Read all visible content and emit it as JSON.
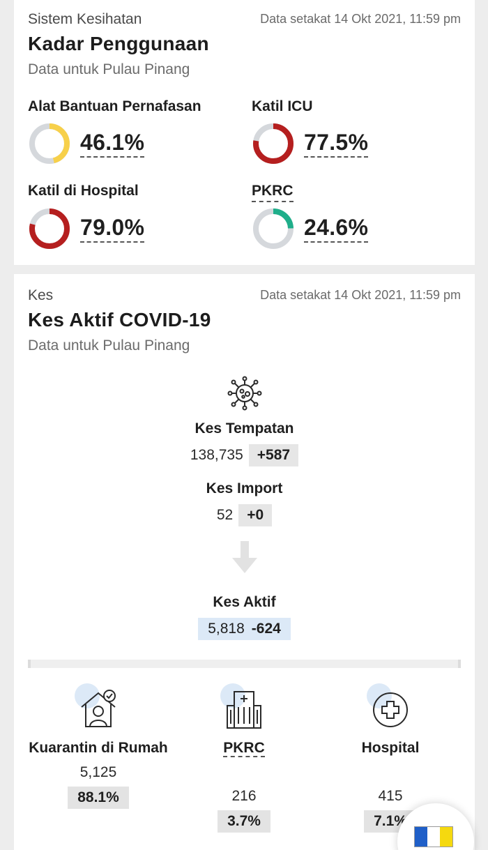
{
  "usage_card": {
    "eyebrow": "Sistem Kesihatan",
    "as_of": "Data setakat 14 Okt 2021, 11:59 pm",
    "title": "Kadar Penggunaan",
    "subtitle": "Data untuk Pulau Pinang",
    "metrics": [
      {
        "label": "Alat Bantuan Pernafasan",
        "value": "46.1%",
        "fraction": 0.461,
        "color": "#f7d04a"
      },
      {
        "label": "Katil ICU",
        "value": "77.5%",
        "fraction": 0.775,
        "color": "#b51f1f"
      },
      {
        "label": "Katil di Hospital",
        "value": "79.0%",
        "fraction": 0.79,
        "color": "#b51f1f"
      },
      {
        "label": "PKRC",
        "value": "24.6%",
        "fraction": 0.246,
        "color": "#1fae8a"
      }
    ],
    "track_color": "#d5d8dc"
  },
  "cases_card": {
    "eyebrow": "Kes",
    "as_of": "Data setakat 14 Okt 2021, 11:59 pm",
    "title": "Kes Aktif COVID-19",
    "subtitle": "Data untuk Pulau Pinang",
    "virus_icon": "virus-icon",
    "local": {
      "label": "Kes Tempatan",
      "total": "138,735",
      "change": "+587"
    },
    "import": {
      "label": "Kes Import",
      "total": "52",
      "change": "+0"
    },
    "arrow_icon": "arrow-down-icon",
    "active": {
      "label": "Kes Aktif",
      "total": "5,818",
      "change": "-624"
    },
    "breakdown": [
      {
        "icon": "home-quarantine-icon",
        "label": "Kuarantin di Rumah",
        "count": "5,125",
        "pct": "88.1%"
      },
      {
        "icon": "building-icon",
        "label": "PKRC",
        "count": "216",
        "pct": "3.7%"
      },
      {
        "icon": "medical-cross-icon",
        "label": "Hospital",
        "count": "415",
        "pct": "7.1%"
      }
    ]
  },
  "accent_blue": "#dce9f7"
}
